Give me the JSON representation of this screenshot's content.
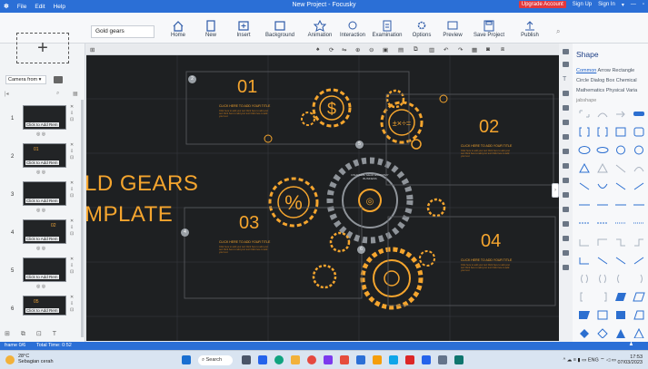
{
  "titlebar": {
    "menu": [
      "File",
      "Edit",
      "Help"
    ],
    "title": "New Project - Focusky",
    "upgrade": "Upgrade Account",
    "signup": "Sign Up",
    "signin": "Sign In"
  },
  "ribbon": {
    "project_name": "Gold gears",
    "tools": [
      "Home",
      "New",
      "Insert",
      "Background",
      "Animation",
      "Interaction",
      "Examination",
      "Options",
      "Preview",
      "Save Project",
      "Publish"
    ]
  },
  "left_panel": {
    "add_symbol": "+",
    "camera_label": "Camera from",
    "slides": [
      {
        "index": "1",
        "num": "",
        "label": "Click to Add Rem"
      },
      {
        "index": "2",
        "num": "01",
        "label": "Click to Add Rem"
      },
      {
        "index": "3",
        "num": "",
        "label": "Click to Add Rem"
      },
      {
        "index": "4",
        "num": "02",
        "label": "Click to Add Rem"
      },
      {
        "index": "5",
        "num": "",
        "label": "Click to Add Rem"
      },
      {
        "index": "6",
        "num": "05",
        "label": "Click to Add Rem"
      }
    ]
  },
  "canvas": {
    "title_line1": "LD GEARS",
    "title_line2": "MPLATE",
    "sections": [
      {
        "num": "01",
        "cta": "CLICK HERE TO ADD YOUR TITLE",
        "frame_badge": "2"
      },
      {
        "num": "02",
        "cta": "CLICK HERE TO ADD YOUR TITLE",
        "frame_badge": "5"
      },
      {
        "num": "03",
        "cta": "CLICK HERE TO ADD YOUR TITLE",
        "frame_badge": "4"
      },
      {
        "num": "04",
        "cta": "CLICK HERE TO ADD YOUR TITLE",
        "frame_badge": "6"
      }
    ],
    "body_text": "Click here to add your text Click here to add your text Click here to add your text Click here to add your text",
    "center_text": "FINANCIAL GEAR ECONOMY BUSINESS"
  },
  "right_panel": {
    "title": "Shape",
    "categories_row1": [
      "Common",
      "Arrow",
      "Rectangle"
    ],
    "categories_row2": [
      "Circle",
      "Dialog Box",
      "Chemical"
    ],
    "categories_row3": [
      "Mathematics",
      "Physical",
      "Varia"
    ],
    "subcat": "jabshape"
  },
  "statusbar": {
    "frame": "frame 0/6",
    "total_time": "Total Time: 0:52"
  },
  "taskbar": {
    "temp": "28°C",
    "weather": "Sebagian cerah",
    "search": "Search",
    "lang": "ENG",
    "time": "17:53",
    "date": "07/03/2023"
  },
  "colors": {
    "accent": "#2b6fd6",
    "gold": "#f5a52e",
    "canvas_bg": "#1e2022",
    "upgrade": "#e2393d"
  }
}
